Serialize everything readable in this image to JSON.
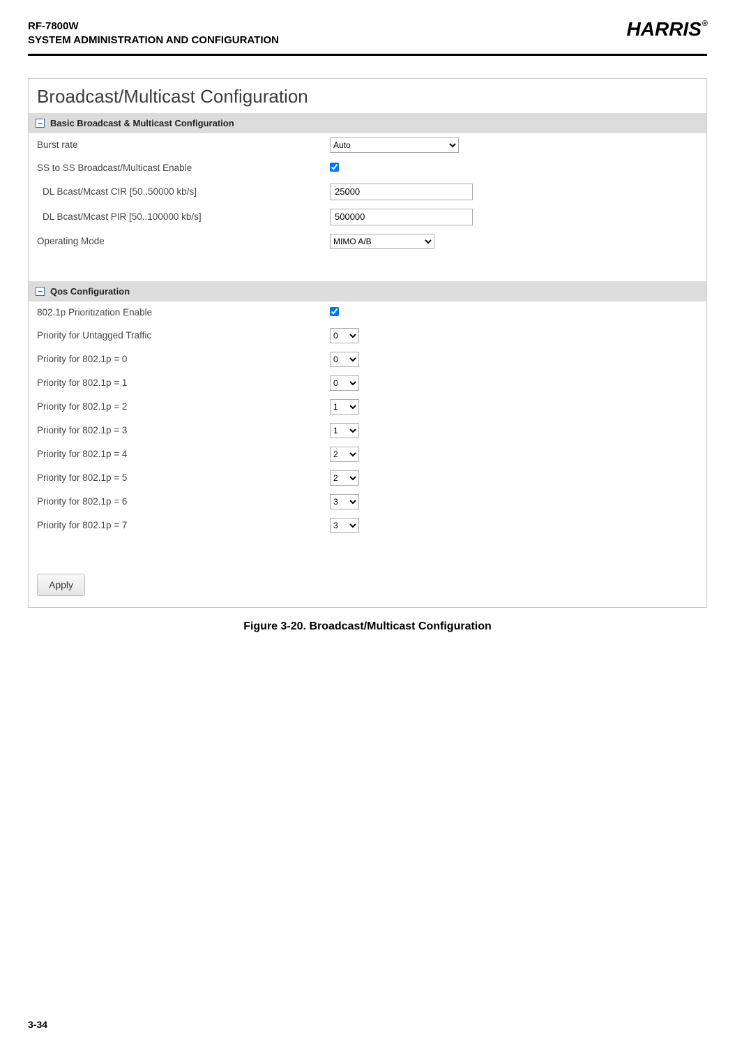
{
  "header": {
    "model": "RF-7800W",
    "subtitle": "SYSTEM ADMINISTRATION AND CONFIGURATION",
    "brand": "HARRIS",
    "reg": "®"
  },
  "panel": {
    "title": "Broadcast/Multicast Configuration"
  },
  "section1": {
    "toggle": "−",
    "title": "Basic Broadcast & Multicast Configuration",
    "rows": {
      "burst_rate_label": "Burst rate",
      "burst_rate_value": "Auto",
      "ss_enable_label": "SS to SS Broadcast/Multicast Enable",
      "ss_enable_checked": true,
      "cir_label": "DL Bcast/Mcast CIR [50..50000 kb/s]",
      "cir_value": "25000",
      "pir_label": "DL Bcast/Mcast PIR [50..100000 kb/s]",
      "pir_value": "500000",
      "opmode_label": "Operating Mode",
      "opmode_value": "MIMO A/B"
    }
  },
  "section2": {
    "toggle": "−",
    "title": "Qos Configuration",
    "rows": {
      "prio_enable_label": "802.1p Prioritization Enable",
      "prio_enable_checked": true,
      "untagged_label": "Priority for Untagged Traffic",
      "untagged_value": "0",
      "p0_label": "Priority for 802.1p = 0",
      "p0_value": "0",
      "p1_label": "Priority for 802.1p = 1",
      "p1_value": "0",
      "p2_label": "Priority for 802.1p = 2",
      "p2_value": "1",
      "p3_label": "Priority for 802.1p = 3",
      "p3_value": "1",
      "p4_label": "Priority for 802.1p = 4",
      "p4_value": "2",
      "p5_label": "Priority for 802.1p = 5",
      "p5_value": "2",
      "p6_label": "Priority for 802.1p = 6",
      "p6_value": "3",
      "p7_label": "Priority for 802.1p = 7",
      "p7_value": "3"
    }
  },
  "buttons": {
    "apply": "Apply"
  },
  "caption": "Figure 3-20.  Broadcast/Multicast Configuration",
  "footer": {
    "page": "3-34"
  }
}
